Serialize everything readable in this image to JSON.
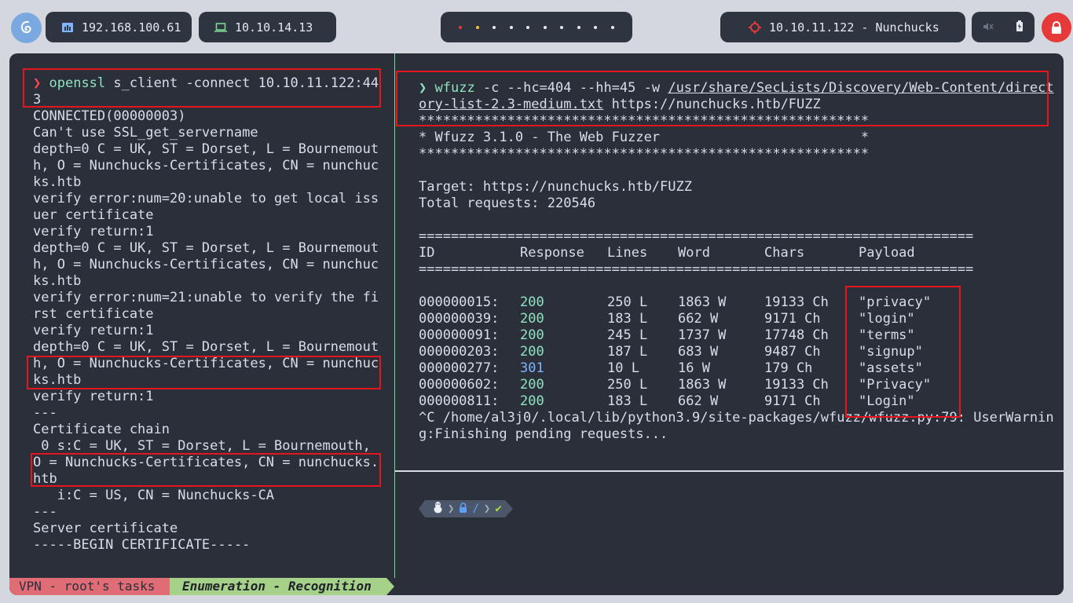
{
  "topbar": {
    "left_ip": "192.168.100.61",
    "vpn_ip": "10.10.14.13",
    "target": "10.10.11.122 - Nunchucks",
    "workspaces": 10
  },
  "left_pane": {
    "prompt_symbol": "❯",
    "command_line1": "openssl s_client -connect 10.10.11.122:44",
    "command_line2": "3",
    "lines": [
      "CONNECTED(00000003)",
      "Can't use SSL_get_servername",
      "depth=0 C = UK, ST = Dorset, L = Bournemout",
      "h, O = Nunchucks-Certificates, CN = nunchuc",
      "ks.htb",
      "verify error:num=20:unable to get local iss",
      "uer certificate",
      "verify return:1",
      "depth=0 C = UK, ST = Dorset, L = Bournemout",
      "h, O = Nunchucks-Certificates, CN = nunchuc",
      "ks.htb",
      "verify error:num=21:unable to verify the fi",
      "rst certificate",
      "verify return:1",
      "depth=0 C = UK, ST = Dorset, L = Bournemout",
      "h, O = Nunchucks-Certificates, CN = nunchuc",
      "ks.htb",
      "verify return:1",
      "---",
      "Certificate chain",
      " 0 s:C = UK, ST = Dorset, L = Bournemouth,",
      "O = Nunchucks-Certificates, CN = nunchucks.",
      "htb",
      "   i:C = US, CN = Nunchucks-CA",
      "---",
      "Server certificate",
      "-----BEGIN CERTIFICATE-----"
    ]
  },
  "right_pane": {
    "prompt_symbol": "❯",
    "cmd_name": "wfuzz",
    "cmd_args": " -c --hc=404 --hh=45 -w ",
    "wordlist_1": "/usr/share/SecLists/Discovery/Web-Content/direct",
    "wordlist_2": "ory-list-2.3-medium.txt",
    "cmd_url": " https://nunchucks.htb/FUZZ",
    "stars": "********************************************************",
    "banner": "* Wfuzz 3.1.0 - The Web Fuzzer                         *",
    "target": "Target: https://nunchucks.htb/FUZZ",
    "total": "Total requests: 220546",
    "rule": "=====================================================================",
    "headers": [
      "ID",
      "Response",
      "Lines",
      "Word",
      "Chars",
      "Payload"
    ],
    "rows": [
      {
        "id": "000000015:",
        "resp": "200",
        "lines": "250 L",
        "word": "1863 W",
        "chars": "19133 Ch",
        "payload": "\"privacy\""
      },
      {
        "id": "000000039:",
        "resp": "200",
        "lines": "183 L",
        "word": "662 W",
        "chars": "9171 Ch",
        "payload": "\"login\""
      },
      {
        "id": "000000091:",
        "resp": "200",
        "lines": "245 L",
        "word": "1737 W",
        "chars": "17748 Ch",
        "payload": "\"terms\""
      },
      {
        "id": "000000203:",
        "resp": "200",
        "lines": "187 L",
        "word": "683 W",
        "chars": "9487 Ch",
        "payload": "\"signup\""
      },
      {
        "id": "000000277:",
        "resp": "301",
        "lines": "10 L",
        "word": "16 W",
        "chars": "179 Ch",
        "payload": "\"assets\""
      },
      {
        "id": "000000602:",
        "resp": "200",
        "lines": "250 L",
        "word": "1863 W",
        "chars": "19133 Ch",
        "payload": "\"Privacy\""
      },
      {
        "id": "000000811:",
        "resp": "200",
        "lines": "183 L",
        "word": "662 W",
        "chars": "9171 Ch",
        "payload": "\"Login\""
      }
    ],
    "trailer_1": "^C /home/al3j0/.local/lib/python3.9/site-packages/wfuzz/wfuzz.py:79: UserWarnin",
    "trailer_2": "g:Finishing pending requests..."
  },
  "statusbar": {
    "seg1": "VPN - root's tasks",
    "seg2": "Enumeration - Recognition"
  },
  "colors": {
    "status_200": "#8fe3c0",
    "status_301": "#7fb4ff",
    "highlight": "#e5161d"
  }
}
